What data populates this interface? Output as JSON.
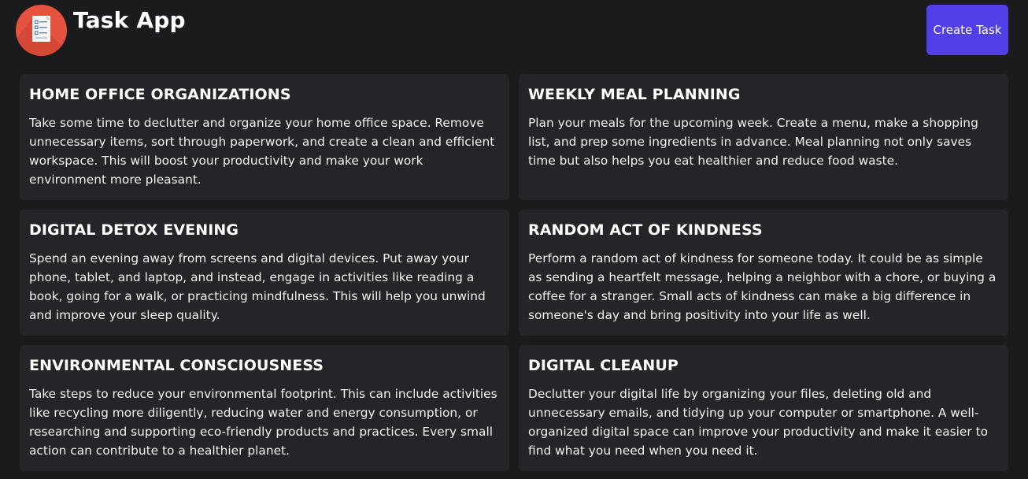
{
  "header": {
    "title": "Task App",
    "create_button_label": "Create Task",
    "logo_icon": "task-list-icon",
    "logo_color": "#e5533f"
  },
  "accent_color": "#5140e8",
  "tasks": [
    {
      "title": "HOME OFFICE ORGANIZATIONS",
      "description": "Take some time to declutter and organize your home office space. Remove unnecessary items, sort through paperwork, and create a clean and efficient workspace. This will boost your productivity and make your work environment more pleasant."
    },
    {
      "title": "WEEKLY MEAL PLANNING",
      "description": "Plan your meals for the upcoming week. Create a menu, make a shopping list, and prep some ingredients in advance. Meal planning not only saves time but also helps you eat healthier and reduce food waste."
    },
    {
      "title": "DIGITAL DETOX EVENING",
      "description": "Spend an evening away from screens and digital devices. Put away your phone, tablet, and laptop, and instead, engage in activities like reading a book, going for a walk, or practicing mindfulness. This will help you unwind and improve your sleep quality."
    },
    {
      "title": "RANDOM ACT OF KINDNESS",
      "description": "Perform a random act of kindness for someone today. It could be as simple as sending a heartfelt message, helping a neighbor with a chore, or buying a coffee for a stranger. Small acts of kindness can make a big difference in someone's day and bring positivity into your life as well."
    },
    {
      "title": "ENVIRONMENTAL CONSCIOUSNESS",
      "description": "Take steps to reduce your environmental footprint. This can include activities like recycling more diligently, reducing water and energy consumption, or researching and supporting eco-friendly products and practices. Every small action can contribute to a healthier planet."
    },
    {
      "title": "DIGITAL CLEANUP",
      "description": "Declutter your digital life by organizing your files, deleting old and unnecessary emails, and tidying up your computer or smartphone. A well-organized digital space can improve your productivity and make it easier to find what you need when you need it."
    }
  ]
}
